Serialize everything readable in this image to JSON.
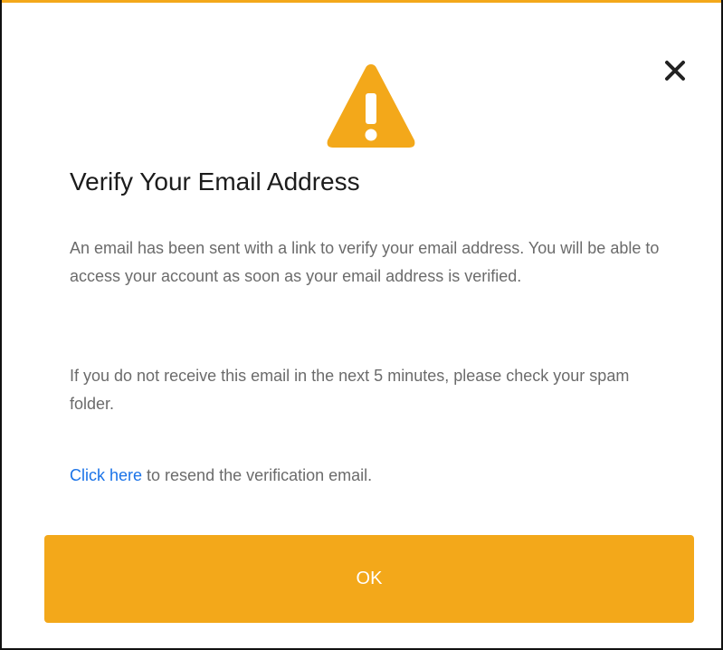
{
  "dialog": {
    "title": "Verify Your Email Address",
    "paragraph_1": "An email has been sent with a link to verify your email address. You will be able to access your account as soon as your email address is verified.",
    "paragraph_2": "If you do not receive this email in the next 5 minutes, please check your spam folder.",
    "resend_link_label": "Click here",
    "resend_suffix": " to resend the verification email.",
    "ok_label": "OK",
    "close_icon": "close-icon",
    "warning_icon": "warning-icon"
  },
  "colors": {
    "accent": "#f3a81a",
    "link": "#1a73e8",
    "title_text": "#1c1c1c",
    "body_text": "#6b6b6b",
    "button_text": "#ffffff"
  }
}
